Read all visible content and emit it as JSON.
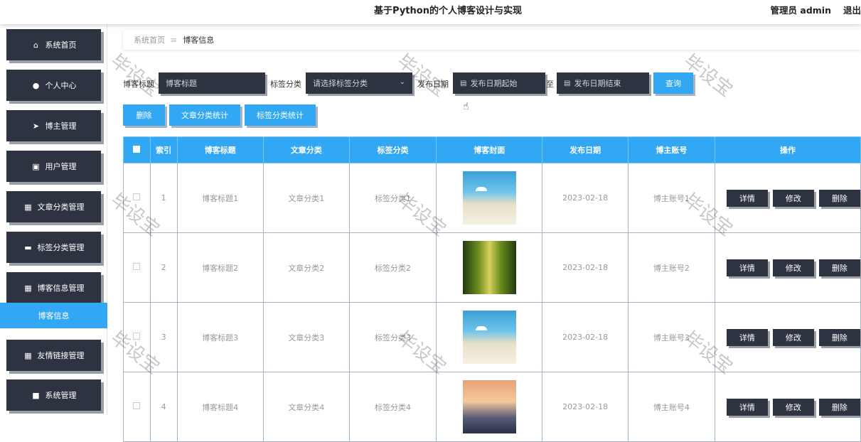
{
  "header": {
    "title": "基于Python的个人博客设计与实现",
    "user": "管理员 admin",
    "logout": "退出"
  },
  "sidebar": {
    "items": [
      {
        "label": "系统首页",
        "icon": "home-icon",
        "glyph": "⌂"
      },
      {
        "label": "个人中心",
        "icon": "user-icon",
        "glyph": "●"
      },
      {
        "label": "博主管理",
        "icon": "send-icon",
        "glyph": "➤"
      },
      {
        "label": "用户管理",
        "icon": "clipboard-icon",
        "glyph": "▣"
      },
      {
        "label": "文章分类管理",
        "icon": "grid-icon",
        "glyph": "▦"
      },
      {
        "label": "标签分类管理",
        "icon": "comment-icon",
        "glyph": "▬"
      },
      {
        "label": "博客信息管理",
        "icon": "grid-icon",
        "glyph": "▦"
      },
      {
        "label": "友情链接管理",
        "icon": "grid-icon",
        "glyph": "▦"
      },
      {
        "label": "系统管理",
        "icon": "settings-icon",
        "glyph": "■"
      }
    ],
    "active_sub": "博客信息"
  },
  "breadcrumb": {
    "home": "系统首页",
    "sep": "≡",
    "current": "博客信息"
  },
  "search": {
    "title_label": "博客标题",
    "title_placeholder": "博客标题",
    "tag_label": "标签分类",
    "tag_placeholder": "请选择标签分类",
    "date_label": "发布日期",
    "date_start": "发布日期起始",
    "date_to": "至",
    "date_end": "发布日期结束",
    "query": "查询"
  },
  "actions": {
    "delete": "删除",
    "article_stats": "文章分类统计",
    "tag_stats": "标签分类统计"
  },
  "table": {
    "headers": [
      "",
      "索引",
      "博客标题",
      "文章分类",
      "标签分类",
      "博客封面",
      "发布日期",
      "博主账号",
      "操作"
    ],
    "rows": [
      {
        "index": "1",
        "title": "博客标题1",
        "article_cat": "文章分类1",
        "tag_cat": "标签分类1",
        "cover": "beach",
        "date": "2023-02-18",
        "author": "博主账号1"
      },
      {
        "index": "2",
        "title": "博客标题2",
        "article_cat": "文章分类2",
        "tag_cat": "标签分类2",
        "cover": "trees",
        "date": "2023-02-18",
        "author": "博主账号2"
      },
      {
        "index": "3",
        "title": "博客标题3",
        "article_cat": "文章分类3",
        "tag_cat": "标签分类3",
        "cover": "beach",
        "date": "2023-02-18",
        "author": "博主账号3"
      },
      {
        "index": "4",
        "title": "博客标题4",
        "article_cat": "文章分类4",
        "tag_cat": "标签分类4",
        "cover": "sunset",
        "date": "2023-02-18",
        "author": "博主账号4"
      }
    ],
    "op_detail": "详情",
    "op_edit": "修改",
    "op_delete": "删除"
  },
  "watermark": "毕设宝"
}
